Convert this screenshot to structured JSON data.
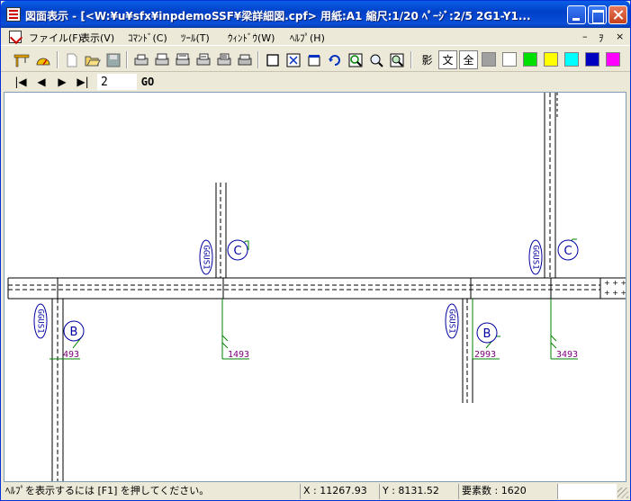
{
  "window": {
    "title": "図面表示 - [<W:¥u¥sfx¥inpdemoSSF¥梁詳細図.cpf> 用紙:A1 縮尺:1/20 ﾍﾟｰｼﾞ:2/5 2G1-Y1...",
    "controls": {
      "minimize": "minimize",
      "maximize": "maximize",
      "close": "close"
    }
  },
  "menu": {
    "items": [
      "ファイル(F)",
      "表示(V)",
      "ｺﾏﾝﾄﾞ(C)",
      "ﾂｰﾙ(T)",
      "ｳｨﾝﾄﾞｳ(W)",
      "ﾍﾙﾌﾟ(H)"
    ],
    "mdi_controls": [
      "–",
      "ｦ",
      "×"
    ]
  },
  "toolbar": {
    "text_buttons": [
      "影",
      "文",
      "全"
    ],
    "swatches": [
      "#a0a0a0",
      "#ffffff",
      "#00e000",
      "#ffff00",
      "#00ffff",
      "#0000c0",
      "#ff00ff"
    ]
  },
  "nav": {
    "first": "|◀",
    "prev": "◀",
    "next": "▶",
    "last": "▶|",
    "page_value": "2",
    "go_label": "GO"
  },
  "drawing": {
    "labels": {
      "gus_top_left": "GGUS1",
      "gus_top_right": "GGUS1",
      "gus_bottom_left": "GGUS1",
      "gus_bottom_right": "GGUS1",
      "circle_c_left": "C",
      "circle_c_right": "C",
      "circle_b_left": "B",
      "circle_b_right": "B",
      "dim_1": "493",
      "dim_2": "1493",
      "dim_3": "2993",
      "dim_4": "3493"
    }
  },
  "status": {
    "help": "ﾍﾙﾌﾟを表示するには [F1] を押してください。",
    "x": "X : 11267.93",
    "y": "Y : 8131.52",
    "count": "要素数 : 1620"
  }
}
